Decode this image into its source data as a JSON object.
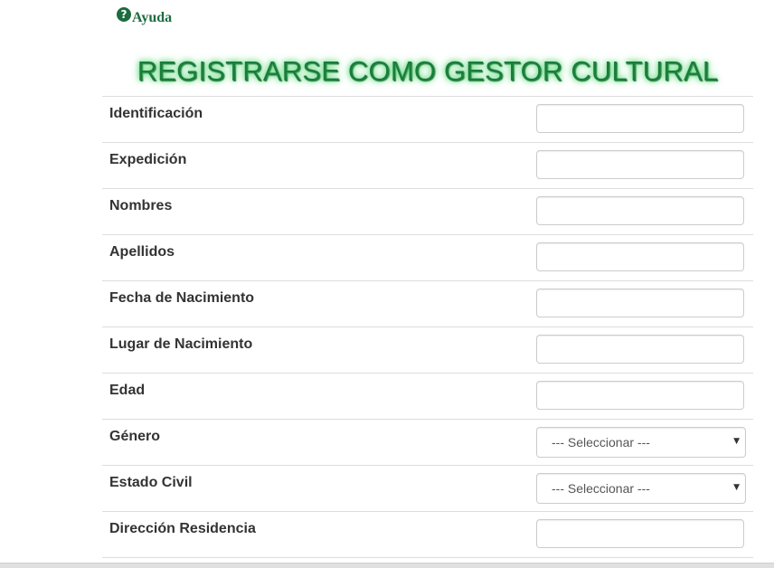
{
  "help": {
    "icon": "question-circle-icon",
    "label": "Ayuda"
  },
  "title": "REGISTRARSE COMO GESTOR CULTURAL",
  "colors": {
    "title": "#1a7d3c",
    "title_glow": "#4ccf6a",
    "help_link": "#1d6b40",
    "label_text": "#333333",
    "row_border": "#dddddd"
  },
  "fields": [
    {
      "label": "Identificación",
      "type": "text",
      "value": ""
    },
    {
      "label": "Expedición",
      "type": "text",
      "value": ""
    },
    {
      "label": "Nombres",
      "type": "text",
      "value": ""
    },
    {
      "label": "Apellidos",
      "type": "text",
      "value": ""
    },
    {
      "label": "Fecha de Nacimiento",
      "type": "text",
      "value": ""
    },
    {
      "label": "Lugar de Nacimiento",
      "type": "text",
      "value": ""
    },
    {
      "label": "Edad",
      "type": "text",
      "value": ""
    },
    {
      "label": "Género",
      "type": "select",
      "selected": "--- Seleccionar ---"
    },
    {
      "label": "Estado Civil",
      "type": "select",
      "selected": "--- Seleccionar ---"
    },
    {
      "label": "Dirección Residencia",
      "type": "text",
      "value": ""
    }
  ]
}
